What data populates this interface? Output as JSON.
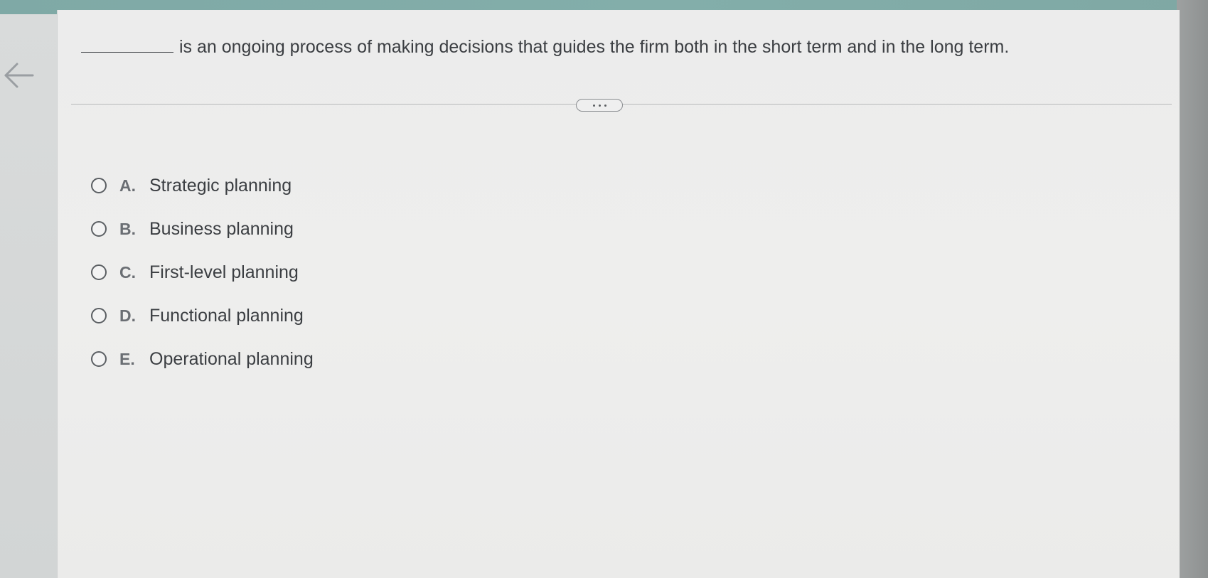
{
  "question": {
    "blank": "________",
    "text": "is an ongoing process of making decisions that guides the firm both in the short term and in the long term."
  },
  "toolbar": {
    "back_icon": "left-arrow-icon",
    "more_icon": "ellipsis-icon"
  },
  "options": [
    {
      "letter": "A.",
      "label": "Strategic planning"
    },
    {
      "letter": "B.",
      "label": "Business planning"
    },
    {
      "letter": "C.",
      "label": "First-level planning"
    },
    {
      "letter": "D.",
      "label": "Functional planning"
    },
    {
      "letter": "E.",
      "label": "Operational planning"
    }
  ],
  "colors": {
    "accent_top": "#7fa9a6",
    "text": "#3b3e42",
    "letter": "#6a6e73"
  }
}
